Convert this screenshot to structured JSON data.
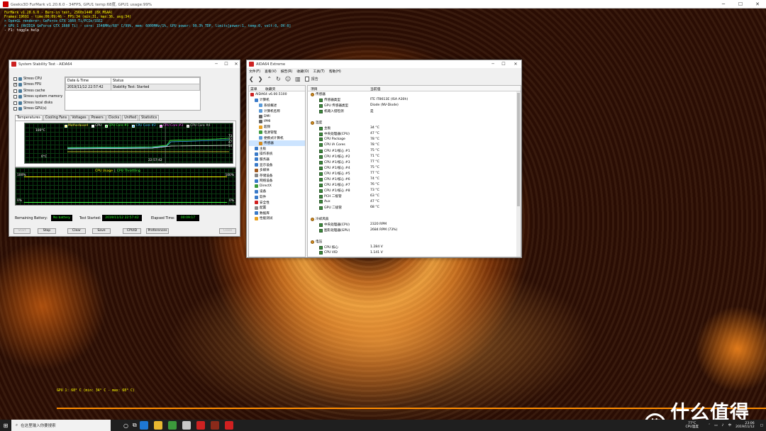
{
  "furmark_window": {
    "title": "Geeks3D FurMark v1.20.6.0 - 34FPS, GPU1 temp:68度, GPU1 usage:99%"
  },
  "osd": {
    "lines": [
      {
        "text": "FurMark v1.20.6.0 - Burn-in test, 2560x1440 (8X MSAA)",
        "color": "#ffff00"
      },
      {
        "text": "Frames:19691 - time:00:09:46 - FPS:34 (min:31, max:36, avg:34)",
        "color": "#ffff00"
      },
      {
        "text": "> OpenGL renderer: GeForce GTX 1660 Ti/PCIe/SSE2",
        "color": "#40e0ff"
      },
      {
        "text": "> GPU 1 (NVIDIA GeForce GTX 1660 Ti) - core: 1546MHz/68° C/99%, mem: 6000MHz/1%, GPU power: 99.3% TDP, limits[power:1, temp:0, volt:0, OV:0]",
        "color": "#40e0ff"
      },
      {
        "text": "- F1: toggle help",
        "color": "#ffffff"
      }
    ],
    "gpu_graph_label": "GPU 1: 68° C (min: 34° C - max: 68° C)"
  },
  "stability": {
    "title": "System Stability Test - AIDA64",
    "checks": [
      {
        "label": "Stress CPU",
        "checked": false
      },
      {
        "label": "Stress FPU",
        "checked": true
      },
      {
        "label": "Stress cache",
        "checked": false
      },
      {
        "label": "Stress system memory",
        "checked": false
      },
      {
        "label": "Stress local disks",
        "checked": false
      },
      {
        "label": "Stress GPU(s)",
        "checked": false
      }
    ],
    "table": {
      "headers": [
        "Date & Time",
        "Status"
      ],
      "row": [
        "2019/11/12 22:57:42",
        "Stability Test: Started"
      ]
    },
    "tabs": [
      "Temperatures",
      "Cooling Fans",
      "Voltages",
      "Powers",
      "Clocks",
      "Unified",
      "Statistics"
    ],
    "temp_graph": {
      "legend": [
        "Motherboard",
        "CPU",
        "CPU Core #1",
        "CPU Core #2",
        "CPU Core #3",
        "CPU Core #4"
      ],
      "legend_colors": [
        "#ffff40",
        "#ffffff",
        "#40ff40",
        "#40c0ff",
        "#ff40ff",
        "#c0c0c0"
      ],
      "ymax": "100°C",
      "ymin": "0°C",
      "time": "22:57:42",
      "right_vals": [
        "73",
        "77",
        "47",
        "34"
      ]
    },
    "usage_graph": {
      "title": "CPU Usage",
      "sep": "|",
      "title2": "CPU Throttling",
      "l100": "100%",
      "l0": "0%",
      "r100": "100%",
      "r0": "0%"
    },
    "remaining_label": "Remaining Battery:",
    "remaining_val": "No battery",
    "started_label": "Test Started:",
    "started_val": "2019/11/12 22:57:42",
    "elapsed_label": "Elapsed Time:",
    "elapsed_val": "00:09:17",
    "buttons": [
      "Start",
      "Stop",
      "Clear",
      "Save",
      "CPUID",
      "Preferences",
      "Close"
    ]
  },
  "aida": {
    "title": "AIDA64 Extreme",
    "menu": [
      "文件(F)",
      "查看(V)",
      "报告(R)",
      "收藏(O)",
      "工具(T)",
      "帮助(H)"
    ],
    "toolbar_report": "报告",
    "tree_headers": [
      "菜单",
      "收藏夹"
    ],
    "tree": [
      {
        "label": "AIDA64 v6.00.5100",
        "indent": 0
      },
      {
        "label": "计算机",
        "indent": 1
      },
      {
        "label": "系统概述",
        "indent": 2
      },
      {
        "label": "计算机名称",
        "indent": 2
      },
      {
        "label": "DMI",
        "indent": 2
      },
      {
        "label": "IPMI",
        "indent": 2
      },
      {
        "label": "超频",
        "indent": 2
      },
      {
        "label": "电源管理",
        "indent": 2
      },
      {
        "label": "便携式计算机",
        "indent": 2
      },
      {
        "label": "传感器",
        "indent": 2
      },
      {
        "label": "主板",
        "indent": 1
      },
      {
        "label": "操作系统",
        "indent": 1
      },
      {
        "label": "服务器",
        "indent": 1
      },
      {
        "label": "显示设备",
        "indent": 1
      },
      {
        "label": "多媒体",
        "indent": 1
      },
      {
        "label": "存储设备",
        "indent": 1
      },
      {
        "label": "网络设备",
        "indent": 1
      },
      {
        "label": "DirectX",
        "indent": 1
      },
      {
        "label": "设备",
        "indent": 1
      },
      {
        "label": "软件",
        "indent": 1
      },
      {
        "label": "安全性",
        "indent": 1
      },
      {
        "label": "配置",
        "indent": 1
      },
      {
        "label": "数据库",
        "indent": 1
      },
      {
        "label": "性能测试",
        "indent": 1
      }
    ],
    "list_headers": [
      "项目",
      "当前值"
    ],
    "list": [
      {
        "type": "sec",
        "field": "传感器",
        "value": ""
      },
      {
        "type": "row",
        "field": "传感器类型",
        "value": "ITE IT8613E (ISA A30h)"
      },
      {
        "type": "row",
        "field": "GPU 传感器类型",
        "value": "Diode (NV-Diode)"
      },
      {
        "type": "row",
        "field": "机箱入侵检测",
        "value": "是"
      },
      {
        "type": "gap",
        "field": "",
        "value": ""
      },
      {
        "type": "sec",
        "field": "温度",
        "value": ""
      },
      {
        "type": "row",
        "field": "主板",
        "value": "34 °C"
      },
      {
        "type": "row",
        "field": "中央处理器(CPU)",
        "value": "47 °C"
      },
      {
        "type": "row",
        "field": "CPU Package",
        "value": "78 °C"
      },
      {
        "type": "row",
        "field": "CPU IA Cores",
        "value": "78 °C"
      },
      {
        "type": "row",
        "field": "CPU #1/核心 #1",
        "value": "75 °C"
      },
      {
        "type": "row",
        "field": "CPU #1/核心 #2",
        "value": "71 °C"
      },
      {
        "type": "row",
        "field": "CPU #1/核心 #3",
        "value": "77 °C"
      },
      {
        "type": "row",
        "field": "CPU #1/核心 #4",
        "value": "75 °C"
      },
      {
        "type": "row",
        "field": "CPU #1/核心 #5",
        "value": "77 °C"
      },
      {
        "type": "row",
        "field": "CPU #1/核心 #6",
        "value": "74 °C"
      },
      {
        "type": "row",
        "field": "CPU #1/核心 #7",
        "value": "76 °C"
      },
      {
        "type": "row",
        "field": "CPU #1/核心 #8",
        "value": "73 °C"
      },
      {
        "type": "row",
        "field": "PCH 二极管",
        "value": "63 °C"
      },
      {
        "type": "row",
        "field": "Aux",
        "value": "47 °C"
      },
      {
        "type": "row",
        "field": "GPU 二极管",
        "value": "68 °C"
      },
      {
        "type": "gap",
        "field": "",
        "value": ""
      },
      {
        "type": "sec",
        "field": "冷却风扇",
        "value": ""
      },
      {
        "type": "row",
        "field": "中央处理器(CPU)",
        "value": "2320 RPM"
      },
      {
        "type": "row",
        "field": "图形处理器(GPU)",
        "value": "2684 RPM  (73%)"
      },
      {
        "type": "gap",
        "field": "",
        "value": ""
      },
      {
        "type": "sec",
        "field": "电压",
        "value": ""
      },
      {
        "type": "row",
        "field": "CPU 核心",
        "value": "1.284 V"
      },
      {
        "type": "row",
        "field": "CPU VID",
        "value": "1.141 V"
      }
    ]
  },
  "taskbar": {
    "search": "在这里输入你要搜索",
    "cpu_temp": "77°C",
    "cpu_temp_label": "CPU温度",
    "time": "23:06",
    "date": "2019/11/12"
  },
  "brand": {
    "logo": "值",
    "text": "什么值得买"
  }
}
